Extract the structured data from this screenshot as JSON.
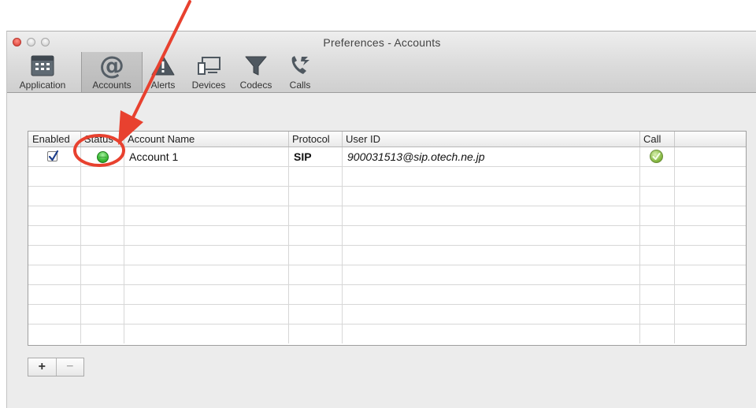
{
  "window": {
    "title": "Preferences - Accounts"
  },
  "toolbar": {
    "items": [
      {
        "label": "Application",
        "icon": "calendar-grid-icon"
      },
      {
        "label": "Accounts",
        "icon": "at-sign-icon",
        "selected": true
      },
      {
        "label": "Alerts",
        "icon": "warning-triangle-icon"
      },
      {
        "label": "Devices",
        "icon": "devices-monitor-icon"
      },
      {
        "label": "Codecs",
        "icon": "funnel-filter-icon"
      },
      {
        "label": "Calls",
        "icon": "phone-call-icon"
      }
    ]
  },
  "table": {
    "columns": [
      "Enabled",
      "Status",
      "Account Name",
      "Protocol",
      "User ID",
      "Call",
      ""
    ],
    "rows": [
      {
        "enabled": true,
        "status": "online",
        "account_name": "Account 1",
        "protocol": "SIP",
        "user_id": "900031513@sip.otech.ne.jp",
        "call": "checkmark-ok"
      }
    ]
  },
  "buttons": {
    "add": "+",
    "remove": "−"
  },
  "colors": {
    "annotation": "#e8412f",
    "status_online": "#3fbf3a",
    "selected_tab": "#bcbcbc"
  }
}
